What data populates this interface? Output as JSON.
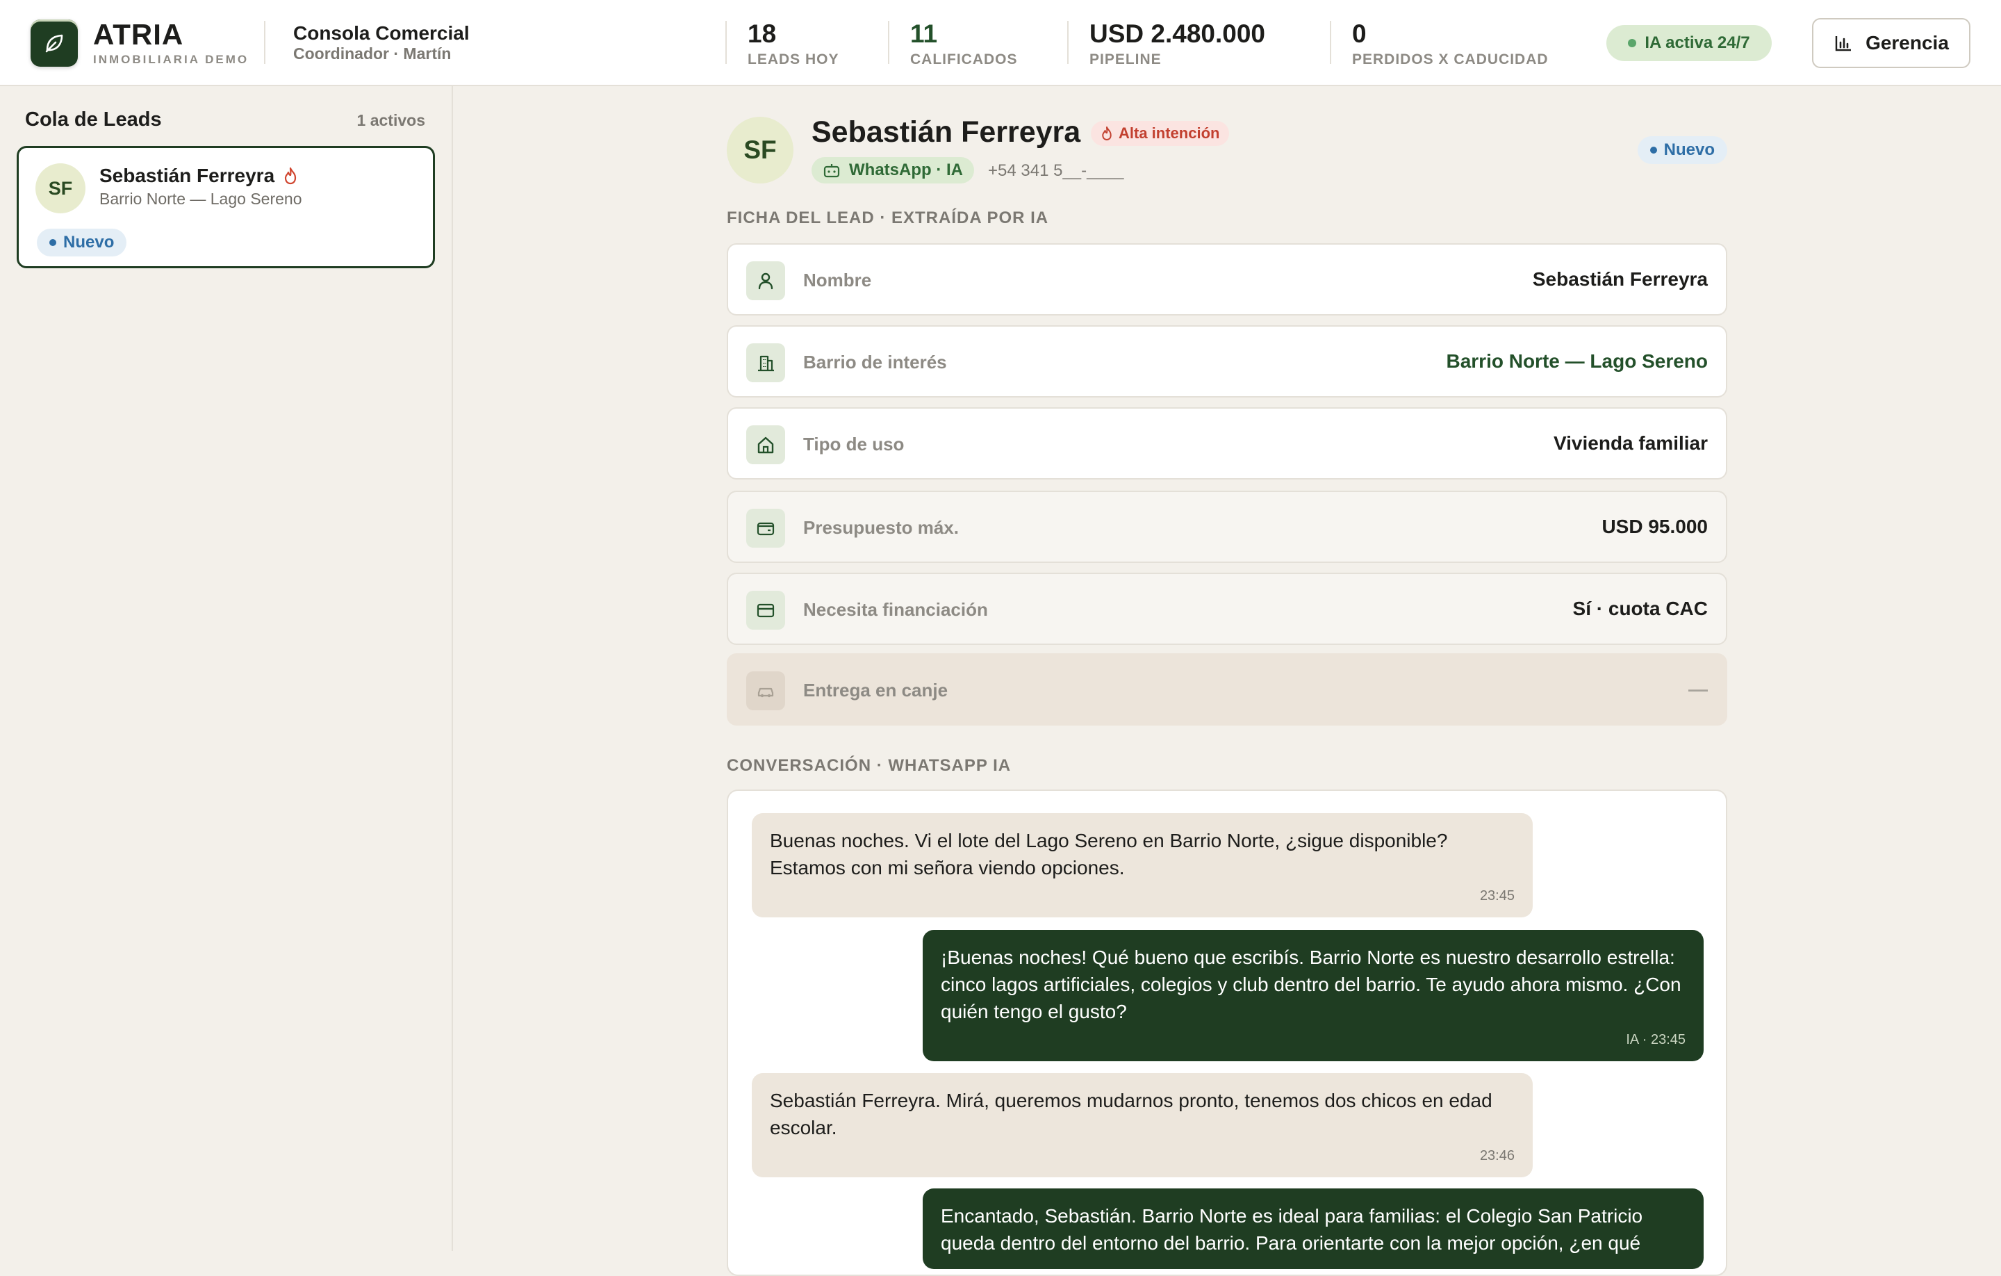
{
  "brand": {
    "name": "ATRIA",
    "subtitle": "INMOBILIARIA DEMO"
  },
  "console": {
    "title": "Consola Comercial",
    "subtitle": "Coordinador · Martín"
  },
  "kpis": [
    {
      "value": "18",
      "label": "LEADS HOY"
    },
    {
      "value": "11",
      "label": "CALIFICADOS"
    },
    {
      "value": "USD 2.480.000",
      "label": "PIPELINE"
    },
    {
      "value": "0",
      "label": "PERDIDOS X CADUCIDAD"
    }
  ],
  "ia_status": "IA activa 24/7",
  "gerencia_label": "Gerencia",
  "sidebar": {
    "title": "Cola de Leads",
    "count": "1 activos",
    "leads": [
      {
        "initials": "SF",
        "name": "Sebastián Ferreyra",
        "location": "Barrio Norte — Lago Sereno",
        "status": "Nuevo"
      }
    ]
  },
  "lead": {
    "initials": "SF",
    "name": "Sebastián Ferreyra",
    "intent": "Alta intención",
    "channel": "WhatsApp · IA",
    "phone": "+54 341 5__-____",
    "status": "Nuevo"
  },
  "ficha": {
    "title": "FICHA DEL LEAD · EXTRAÍDA POR IA",
    "fields": [
      {
        "icon": "person-icon",
        "label": "Nombre",
        "value": "Sebastián Ferreyra"
      },
      {
        "icon": "building-icon",
        "label": "Barrio de interés",
        "value": "Barrio Norte — Lago Sereno"
      },
      {
        "icon": "home-icon",
        "label": "Tipo de uso",
        "value": "Vivienda familiar"
      },
      {
        "icon": "wallet-icon",
        "label": "Presupuesto máx.",
        "value": "USD 95.000"
      },
      {
        "icon": "credit-card-icon",
        "label": "Necesita financiación",
        "value": "Sí · cuota CAC"
      },
      {
        "icon": "car-icon",
        "label": "Entrega en canje",
        "value": "—"
      }
    ]
  },
  "conversation": {
    "title": "CONVERSACIÓN · WHATSAPP IA",
    "messages": [
      {
        "from": "lead",
        "text": "Buenas noches. Vi el lote del Lago Sereno en Barrio Norte, ¿sigue disponible? Estamos con mi señora viendo opciones.",
        "time": "23:45"
      },
      {
        "from": "ia",
        "text": "¡Buenas noches! Qué bueno que escribís. Barrio Norte es nuestro desarrollo estrella: cinco lagos artificiales, colegios y club dentro del barrio. Te ayudo ahora mismo. ¿Con quién tengo el gusto?",
        "time": "IA · 23:45"
      },
      {
        "from": "lead",
        "text": "Sebastián Ferreyra. Mirá, queremos mudarnos pronto, tenemos dos chicos en edad escolar.",
        "time": "23:46"
      },
      {
        "from": "ia",
        "text": "Encantado, Sebastián. Barrio Norte es ideal para familias: el Colegio San Patricio queda dentro del entorno del barrio. Para orientarte con la mejor opción, ¿en qué",
        "time": ""
      }
    ]
  },
  "colors": {
    "brand_green": "#1f3d22",
    "accent_green": "#2f6a36",
    "status_blue": "#2e6ea6",
    "intent_red": "#c2402f",
    "background": "#f3f0ea"
  }
}
